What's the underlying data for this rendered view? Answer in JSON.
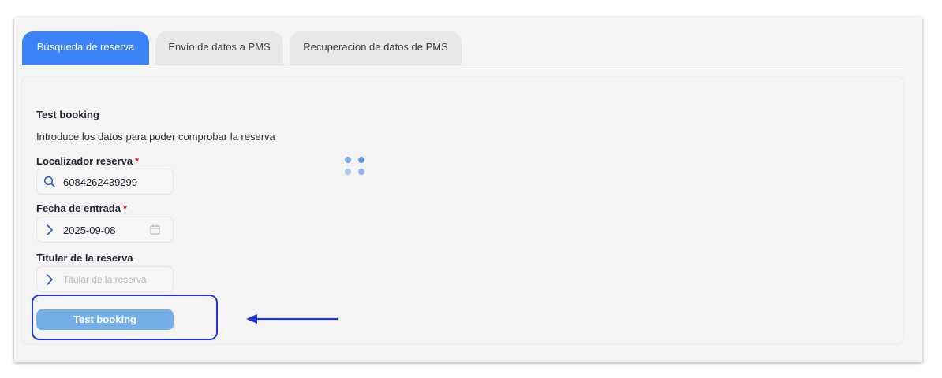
{
  "tabs": [
    {
      "label": "Búsqueda de reserva",
      "active": true
    },
    {
      "label": "Envío de datos a PMS",
      "active": false
    },
    {
      "label": "Recuperacion de datos de PMS",
      "active": false
    }
  ],
  "form": {
    "title": "Test booking",
    "intro": "Introduce los datos para poder comprobar la reserva",
    "fields": {
      "localizador": {
        "label": "Localizador reserva",
        "required_mark": "*",
        "value": "6084262439299",
        "icon": "search-icon"
      },
      "fecha": {
        "label": "Fecha de entrada",
        "required_mark": "*",
        "value": "2025-09-08",
        "icon": "chevron-right-icon",
        "trailing_icon": "calendar-icon"
      },
      "titular": {
        "label": "Titular de la reserva",
        "placeholder": "Titular de la reserva",
        "icon": "chevron-right-icon"
      }
    },
    "submit_label": "Test booking"
  },
  "colors": {
    "accent": "#3b82f6",
    "button": "#74afe8",
    "required": "#e11d2e",
    "annotation": "#1f36d6"
  },
  "annotation": {
    "type": "highlight-box-with-arrow",
    "target": "test-booking-button"
  },
  "loading_indicator": {
    "icon": "loading-dots-icon"
  }
}
